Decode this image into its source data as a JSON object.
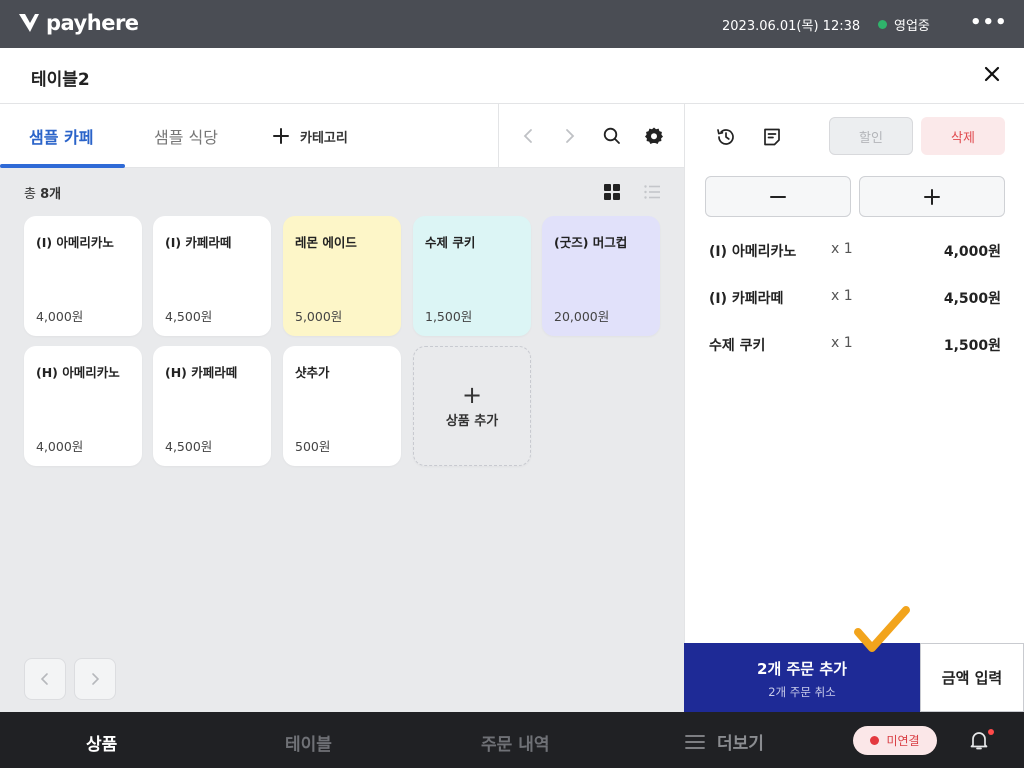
{
  "app": {
    "brand": "payhere",
    "datetime": "2023.06.01(목) 12:38",
    "status_label": "영업중",
    "status_color": "#2fb36b",
    "more_icon": "more-horizontal-icon"
  },
  "header": {
    "title": "테이블2",
    "close_icon": "close-icon"
  },
  "category_tabs": {
    "tabs": [
      {
        "label": "샘플 카페",
        "active": true
      },
      {
        "label": "샘플 식당",
        "active": false
      }
    ],
    "add_category_label": "카테고리",
    "tools": [
      "chevron-left-icon",
      "chevron-right-icon",
      "search-icon",
      "gear-icon"
    ]
  },
  "products": {
    "count_prefix": "총 ",
    "count_value": "8개",
    "view_modes": [
      "grid-view-icon",
      "list-view-icon"
    ],
    "items": [
      {
        "name": "(I) 아메리카노",
        "price": "4,000원",
        "color": "#ffffff"
      },
      {
        "name": "(I) 카페라떼",
        "price": "4,500원",
        "color": "#ffffff"
      },
      {
        "name": "레몬 에이드",
        "price": "5,000원",
        "color": "#fdf6c8"
      },
      {
        "name": "수제 쿠키",
        "price": "1,500원",
        "color": "#dcf5f5"
      },
      {
        "name": "(굿즈) 머그컵",
        "price": "20,000원",
        "color": "#e1e1fa"
      },
      {
        "name": "(H) 아메리카노",
        "price": "4,000원",
        "color": "#ffffff"
      },
      {
        "name": "(H) 카페라떼",
        "price": "4,500원",
        "color": "#ffffff"
      },
      {
        "name": "샷추가",
        "price": "500원",
        "color": "#ffffff"
      }
    ],
    "add_product_label": "상품 추가"
  },
  "order_panel": {
    "tools": [
      "history-icon",
      "memo-icon"
    ],
    "discount_label": "할인",
    "delete_label": "삭제",
    "decrease_icon": "minus-icon",
    "increase_icon": "plus-icon",
    "items": [
      {
        "name": "(I) 아메리카노",
        "qty": "x 1",
        "price": "4,000원"
      },
      {
        "name": "(I) 카페라떼",
        "qty": "x 1",
        "price": "4,500원"
      },
      {
        "name": "수제 쿠키",
        "qty": "x 1",
        "price": "1,500원"
      }
    ]
  },
  "actions": {
    "order_add_label": "2개 주문 추가",
    "order_cancel_label": "2개 주문 취소",
    "amount_input_label": "금액 입력",
    "accent_color": "#1e2a96"
  },
  "bottom_nav": {
    "items": [
      {
        "label": "상품",
        "active": true
      },
      {
        "label": "테이블",
        "active": false
      },
      {
        "label": "주문 내역",
        "active": false
      }
    ],
    "more_label": "더보기",
    "connection_label": "미연결",
    "connection_color": "#e4393f"
  }
}
